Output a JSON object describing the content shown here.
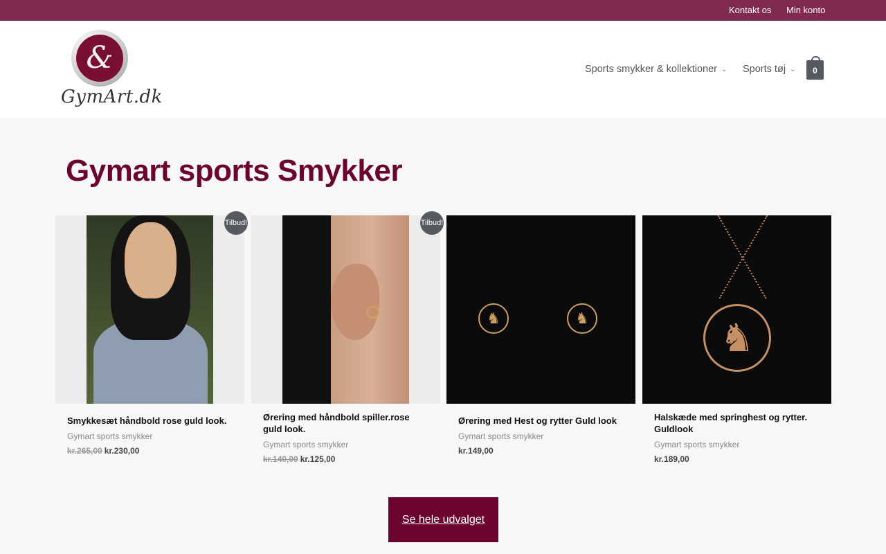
{
  "topbar": {
    "links": [
      "Kontakt os",
      "Min konto"
    ],
    "background": "#7f2a4e"
  },
  "header": {
    "logo_text": "GymArt.dk",
    "nav": [
      {
        "label": "Sports smykker & kollektioner",
        "icon": "chevron-down-icon"
      },
      {
        "label": "Sports tøj",
        "icon": "chevron-down-icon"
      }
    ],
    "cart_count": "0"
  },
  "main": {
    "title": "Gymart sports Smykker",
    "title_color": "#6b0530",
    "products": [
      {
        "title": "Smykkesæt håndbold rose guld look.",
        "category": "Gymart sports smykker",
        "old_price": "kr.265,00",
        "price": "kr.230,00",
        "badge": "Tilbud!"
      },
      {
        "title": "Ørering med håndbold spiller.rose guld look.",
        "category": "Gymart sports smykker",
        "old_price": "kr.140,00",
        "price": "kr.125,00",
        "badge": "Tilbud!"
      },
      {
        "title": "Ørering med Hest og rytter Guld look",
        "category": "Gymart sports smykker",
        "price": "kr.149,00"
      },
      {
        "title": "Halskæde med springhest og rytter. Guldlook",
        "category": "Gymart sports smykker",
        "price": "kr.189,00"
      }
    ],
    "cta_label": "Se hele udvalget"
  }
}
